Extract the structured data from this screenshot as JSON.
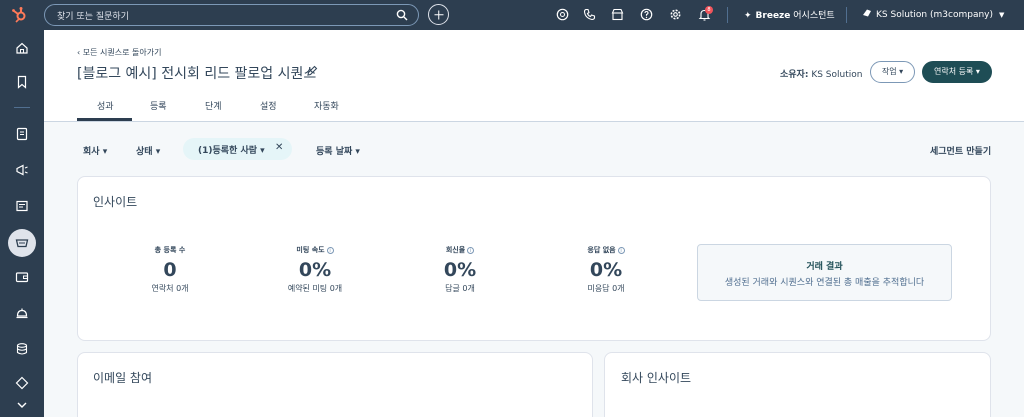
{
  "topbar": {
    "search_placeholder": "찾기 또는 질문하기",
    "notification_count": "8",
    "breeze_brand": "Breeze",
    "breeze_suffix": " 어시스턴트",
    "account_name": "KS Solution (m3company)"
  },
  "header": {
    "back_link": "‹ 모든 시퀀스로 돌아가기",
    "title": "[블로그 예시] 전시회 리드 팔로업 시퀀스",
    "owner_label": "소유자:",
    "owner_name": " KS Solution",
    "action_button": "작업 ▾",
    "enroll_button": "연락처 등록 ▾",
    "tabs": [
      "성과",
      "등록",
      "단계",
      "설정",
      "자동화"
    ]
  },
  "filters": {
    "company": "회사 ▾",
    "status": "상태 ▾",
    "enrolled": "(1)등록한 사람 ▾",
    "enroll_date": "등록 날짜 ▾",
    "create_segment": "세그먼트 만들기"
  },
  "insights": {
    "title": "인사이트",
    "stats": [
      {
        "label": "총 등록 수",
        "value": "0",
        "sub": "연락처 0개",
        "info": false
      },
      {
        "label": "미팅 속도",
        "value": "0%",
        "sub": "예약된 미팅 0개",
        "info": true
      },
      {
        "label": "회신율",
        "value": "0%",
        "sub": "답글 0개",
        "info": true
      },
      {
        "label": "응답 없음",
        "value": "0%",
        "sub": "미응답 0개",
        "info": true
      }
    ],
    "deal_title": "거래 결과",
    "deal_desc": "생성된 거래와 시퀀스와 연결된 총 매출을 추적합니다"
  },
  "email_card": {
    "title": "이메일 참여"
  },
  "company_card": {
    "title": "회사 인사이트"
  },
  "colors": {
    "nav_bg": "#2d3e50",
    "primary_button": "#1e4d55",
    "filter_pill": "#e5f5f8",
    "badge": "#f2545b"
  }
}
